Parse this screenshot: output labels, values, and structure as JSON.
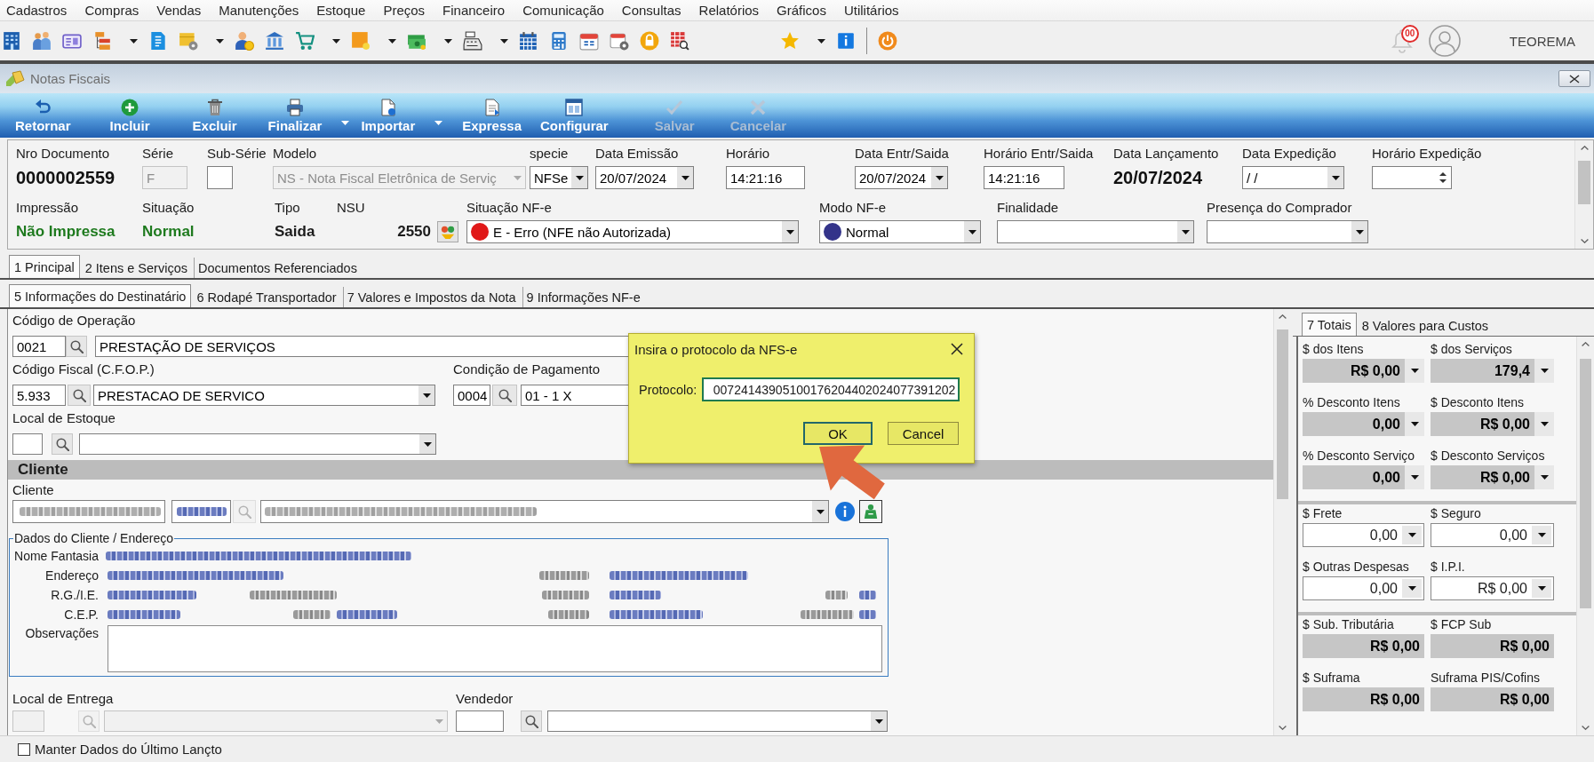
{
  "menu_bar": {
    "items": [
      "Cadastros",
      "Compras",
      "Vendas",
      "Manutenções",
      "Estoque",
      "Preços",
      "Financeiro",
      "Comunicação",
      "Consultas",
      "Relatórios",
      "Gráficos",
      "Utilitários"
    ]
  },
  "toolbar": {
    "buttons": [
      {
        "has_menu": false
      },
      {
        "has_menu": false
      },
      {
        "has_menu": false
      },
      {
        "has_menu": true
      },
      {
        "has_menu": false
      },
      {
        "has_menu": true
      },
      {
        "has_menu": false
      },
      {
        "has_menu": false
      },
      {
        "has_menu": true
      },
      {
        "has_menu": true
      },
      {
        "has_menu": true
      },
      {
        "has_menu": true
      },
      {
        "has_menu": false
      },
      {
        "has_menu": false
      },
      {
        "has_menu": false
      },
      {
        "has_menu": false
      },
      {
        "has_menu": false
      },
      {
        "has_menu": false
      },
      {
        "has_menu": true
      },
      {
        "has_menu": false
      },
      {
        "has_menu": false
      }
    ],
    "notification_count": "00",
    "user": "TEOREMA"
  },
  "window": {
    "title": "Notas Fiscais"
  },
  "ribbon": {
    "buttons": [
      {
        "label": "Retornar",
        "has_menu": false,
        "disabled": false
      },
      {
        "label": "Incluir",
        "has_menu": false,
        "disabled": false
      },
      {
        "label": "Excluir",
        "has_menu": false,
        "disabled": false
      },
      {
        "label": "Finalizar",
        "has_menu": true,
        "disabled": false
      },
      {
        "label": "Importar",
        "has_menu": true,
        "disabled": false
      },
      {
        "label": "Expressa",
        "has_menu": false,
        "disabled": false
      },
      {
        "label": "Configurar",
        "has_menu": false,
        "disabled": false
      },
      {
        "label": "Salvar",
        "has_menu": false,
        "disabled": true
      },
      {
        "label": "Cancelar",
        "has_menu": false,
        "disabled": true
      }
    ]
  },
  "header": {
    "top_fields": [
      {
        "kind": "display",
        "label": "Nro Documento",
        "value": "0000002559",
        "disabled": false
      },
      {
        "kind": "text",
        "label": "Série",
        "value": "F",
        "disabled": true
      },
      {
        "kind": "text",
        "label": "Sub-Série",
        "disabled": false
      },
      {
        "kind": "select",
        "label": "Modelo",
        "value": "NS - Nota Fiscal Eletrônica de Serviç",
        "disabled": true
      },
      {
        "kind": "select",
        "label": "specie",
        "value": "NFSe",
        "disabled": false
      },
      {
        "kind": "select",
        "label": "Data Emissão",
        "value": "20/07/2024",
        "disabled": false
      },
      {
        "kind": "text",
        "label": "Horário",
        "value": "14:21:16",
        "disabled": false
      },
      {
        "kind": "select",
        "label": "Data Entr/Saida",
        "value": "20/07/2024",
        "disabled": false
      },
      {
        "kind": "text",
        "label": "Horário Entr/Saida",
        "value": "14:21:16",
        "disabled": false
      },
      {
        "kind": "display",
        "label": "Data Lançamento",
        "value": "20/07/2024",
        "disabled": false
      },
      {
        "kind": "select",
        "label": "Data Expedição",
        "value": "/ /",
        "disabled": false
      },
      {
        "kind": "spinner",
        "label": "Horário Expedição",
        "disabled": false
      }
    ],
    "bottom_fields": [
      {
        "kind": "display",
        "label": "Impressão",
        "value": "Não Impressa",
        "color": "#1e7a1e",
        "disabled": false
      },
      {
        "kind": "display",
        "label": "Situação",
        "value": "Normal",
        "color": "#1e7a1e",
        "disabled": false
      },
      {
        "kind": "display",
        "label": "Tipo",
        "value": "Saida",
        "color": "#1b1b1b",
        "disabled": false
      },
      {
        "kind": "counter",
        "label": "NSU",
        "value": "2550",
        "disabled": false
      },
      {
        "kind": "status_select",
        "label": "Situação NF-e",
        "value": "E - Erro (NFE não Autorizada)",
        "color": "#e01818",
        "disabled": false
      },
      {
        "kind": "status_select",
        "label": "Modo NF-e",
        "value": "Normal",
        "color": "#34348a",
        "disabled": false
      },
      {
        "kind": "select",
        "label": "Finalidade",
        "disabled": false
      },
      {
        "kind": "select",
        "label": "Presença do Comprador",
        "disabled": false
      }
    ]
  },
  "main_tabs": [
    {
      "label": "1 Principal",
      "selected": true
    },
    {
      "label": "2 Itens e Serviços",
      "selected": false
    },
    {
      "label": "Documentos Referenciados",
      "selected": false
    }
  ],
  "sub_tabs": [
    {
      "label": "5 Informações do Destinatário",
      "selected": true
    },
    {
      "label": "6 Rodapé Transportador",
      "selected": false
    },
    {
      "label": "7 Valores e Impostos da Nota",
      "selected": false
    },
    {
      "label": "9 Informações NF-e",
      "selected": false
    }
  ],
  "destinatario": {
    "top_rows": [
      [
        {
          "label": "Código de Operação",
          "code": "0021",
          "kind": "text",
          "value": "PRESTAÇÃO DE SERVIÇOS",
          "disabled": false
        }
      ],
      [
        {
          "label": "Código Fiscal (C.F.O.P.)",
          "code": "5.933",
          "kind": "select",
          "value": "PRESTACAO DE SERVICO",
          "disabled": false
        },
        {
          "label": "Condição de Pagamento",
          "code": "0004",
          "kind": "select",
          "value": "01 - 1 X",
          "disabled": false
        }
      ],
      [
        {
          "label": "Local de Estoque",
          "kind": "select",
          "disabled": false
        }
      ]
    ],
    "section_title": "Cliente",
    "client": {
      "label": "Cliente",
      "blurred": true
    },
    "address": {
      "title": "Dados do Cliente / Endereço",
      "blurred": true,
      "labels": [
        "Nome Fantasia",
        "Endereço",
        "R.G./I.E.",
        "C.E.P."
      ],
      "notes_label": "Observações"
    },
    "bottom_rows": [
      [
        {
          "label": "Local de Entrega",
          "kind": "select",
          "disabled": true
        },
        {
          "label": "Vendedor",
          "kind": "select",
          "disabled": false
        }
      ]
    ]
  },
  "totals": {
    "tabs": [
      {
        "label": "7 Totais",
        "selected": true
      },
      {
        "label": "8 Valores para Custos",
        "selected": false
      }
    ],
    "groups": [
      {
        "rows": [
          [
            {
              "label": "$ dos Itens",
              "value": "R$ 0,00",
              "kind": "computed",
              "has_menu": true
            },
            {
              "label": "$ dos Serviços",
              "value": "179,4",
              "kind": "computed",
              "has_menu": true
            }
          ],
          [
            {
              "label": "% Desconto Itens",
              "value": "0,00",
              "kind": "computed",
              "has_menu": true
            },
            {
              "label": "$ Desconto Itens",
              "value": "R$ 0,00",
              "kind": "computed",
              "has_menu": true
            }
          ],
          [
            {
              "label": "% Desconto Serviço",
              "value": "0,00",
              "kind": "computed",
              "has_menu": true
            },
            {
              "label": "$ Desconto Serviços",
              "value": "R$ 0,00",
              "kind": "computed",
              "has_menu": true
            }
          ]
        ]
      },
      {
        "rows": [
          [
            {
              "label": "$ Frete",
              "value": "0,00",
              "kind": "input",
              "has_menu": true
            },
            {
              "label": "$ Seguro",
              "value": "0,00",
              "kind": "input",
              "has_menu": true
            }
          ],
          [
            {
              "label": "$ Outras Despesas",
              "value": "0,00",
              "kind": "input",
              "has_menu": true
            },
            {
              "label": "$ I.P.I.",
              "value": "R$ 0,00",
              "kind": "input",
              "has_menu": true
            }
          ]
        ]
      },
      {
        "rows": [
          [
            {
              "label": "$ Sub. Tributária",
              "value": "R$ 0,00",
              "kind": "computed",
              "has_menu": false
            },
            {
              "label": "$ FCP Sub",
              "value": "R$ 0,00",
              "kind": "computed",
              "has_menu": false
            }
          ],
          [
            {
              "label": "$ Suframa",
              "value": "R$ 0,00",
              "kind": "computed",
              "has_menu": false
            },
            {
              "label": "Suframa PIS/Cofins",
              "value": "R$ 0,00",
              "kind": "computed",
              "has_menu": false
            }
          ]
        ]
      }
    ]
  },
  "status_bar": {
    "checkbox": {
      "label": "Manter Dados do Último Lançto",
      "checked": false
    }
  },
  "dialog": {
    "title": "Insira o protocolo da NFS-e",
    "field_label": "Protocolo:",
    "value": "00724143905100176204402024077391202",
    "buttons": [
      {
        "label": "OK",
        "default": true
      },
      {
        "label": "Cancel",
        "default": false
      }
    ]
  }
}
